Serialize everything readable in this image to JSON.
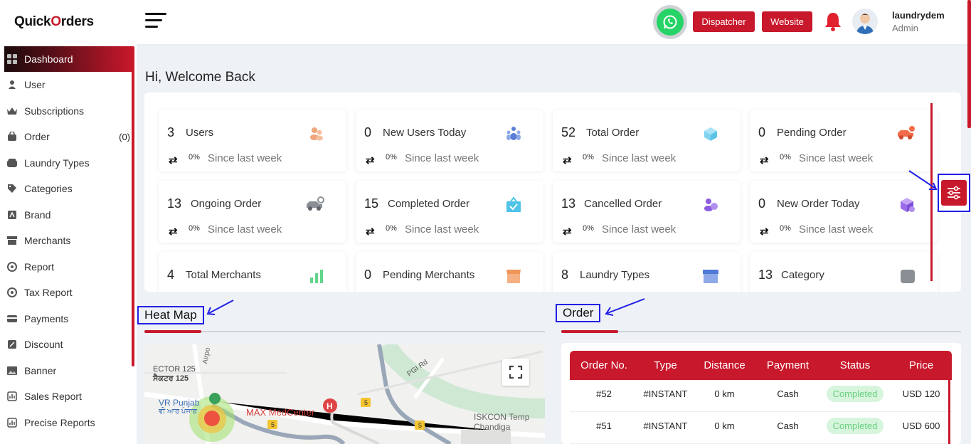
{
  "brand": {
    "logo_pre": "Quick",
    "logo_o": "O",
    "logo_post": "rders"
  },
  "sidebar": {
    "items": [
      {
        "label": "Dashboard",
        "icon": "grid-icon"
      },
      {
        "label": "User",
        "icon": "user-icon"
      },
      {
        "label": "Subscriptions",
        "icon": "crown-icon"
      },
      {
        "label": "Order",
        "icon": "bag-icon",
        "count": "(0)"
      },
      {
        "label": "Laundry Types",
        "icon": "washer-icon"
      },
      {
        "label": "Categories",
        "icon": "tag-icon"
      },
      {
        "label": "Brand",
        "icon": "brand-icon"
      },
      {
        "label": "Merchants",
        "icon": "store-icon"
      },
      {
        "label": "Report",
        "icon": "report-icon"
      },
      {
        "label": "Tax Report",
        "icon": "tax-icon"
      },
      {
        "label": "Payments",
        "icon": "wallet-icon"
      },
      {
        "label": "Discount",
        "icon": "discount-icon"
      },
      {
        "label": "Banner",
        "icon": "image-icon"
      },
      {
        "label": "Sales Report",
        "icon": "chart-icon"
      },
      {
        "label": "Precise Reports",
        "icon": "chart-icon"
      }
    ]
  },
  "header": {
    "dispatcher": "Dispatcher",
    "website": "Website",
    "username": "laundrydem",
    "role": "Admin"
  },
  "welcome": "Hi, Welcome Back",
  "stats": [
    {
      "num": "3",
      "label": "Users",
      "pct": "0%",
      "since": "Since last week",
      "color": "#f0a57a"
    },
    {
      "num": "0",
      "label": "New Users Today",
      "pct": "0%",
      "since": "Since last week",
      "color": "#5b7fd6"
    },
    {
      "num": "52",
      "label": "Total Order",
      "pct": "0%",
      "since": "Since last week",
      "color": "#7fd3ef"
    },
    {
      "num": "0",
      "label": "Pending Order",
      "pct": "0%",
      "since": "Since last week",
      "color": "#f46b4a"
    },
    {
      "num": "13",
      "label": "Ongoing Order",
      "pct": "0%",
      "since": "Since last week",
      "color": "#8a8f96"
    },
    {
      "num": "15",
      "label": "Completed Order",
      "pct": "0%",
      "since": "Since last week",
      "color": "#4fc3e8"
    },
    {
      "num": "13",
      "label": "Cancelled Order",
      "pct": "0%",
      "since": "Since last week",
      "color": "#8a5ce0"
    },
    {
      "num": "0",
      "label": "New Order Today",
      "pct": "0%",
      "since": "Since last week",
      "color": "#9b6be8"
    },
    {
      "num": "4",
      "label": "Total Merchants",
      "color": "#5fd68a"
    },
    {
      "num": "0",
      "label": "Pending Merchants",
      "color": "#f0955a"
    },
    {
      "num": "8",
      "label": "Laundry Types",
      "color": "#4f7ad6"
    },
    {
      "num": "13",
      "label": "Category",
      "color": "#8a8f96"
    }
  ],
  "heatmap": {
    "title": "Heat Map",
    "labels": [
      "ECTOR 125",
      "ਸੈਕਟਰ 125",
      "VR Punjab",
      "ਵੀ ਆਰ ਪੰਜਾਬ",
      "MAX MedCenter",
      "PGI Rd",
      "ISKCON Temp",
      "Chandiga",
      "Airpo",
      "5"
    ]
  },
  "orders": {
    "title": "Order",
    "columns": [
      "Order No.",
      "Type",
      "Distance",
      "Payment",
      "Status",
      "Price"
    ],
    "rows": [
      {
        "no": "#52",
        "type": "#INSTANT",
        "distance": "0 km",
        "payment": "Cash",
        "status": "Completed",
        "price": "USD 120"
      },
      {
        "no": "#51",
        "type": "#INSTANT",
        "distance": "0 km",
        "payment": "Cash",
        "status": "Completed",
        "price": "USD 600"
      }
    ]
  }
}
